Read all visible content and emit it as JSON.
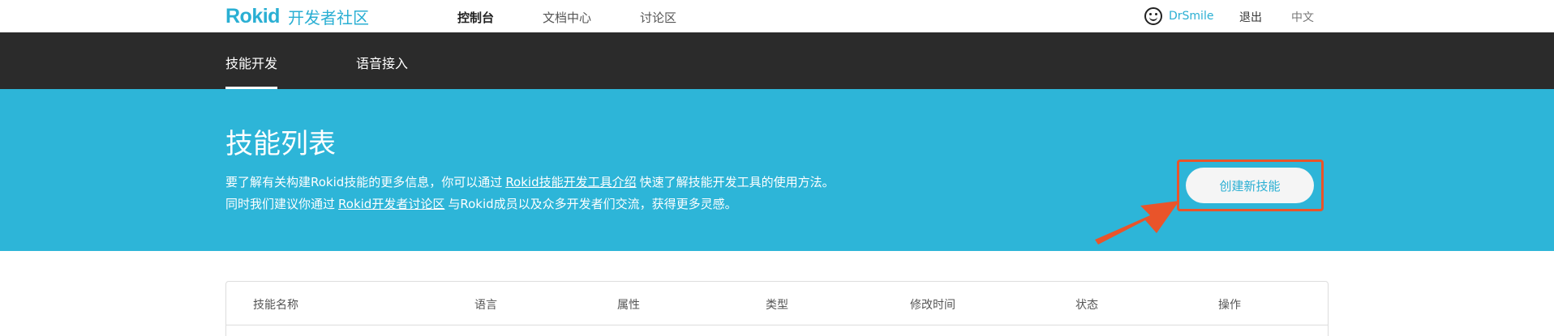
{
  "brand": {
    "logo": "Rokid",
    "name": "开发者社区"
  },
  "nav": {
    "items": [
      "控制台",
      "文档中心",
      "讨论区"
    ]
  },
  "user": {
    "name": "DrSmile",
    "logout": "退出",
    "language": "中文"
  },
  "subnav": {
    "tabs": [
      "技能开发",
      "语音接入"
    ]
  },
  "banner": {
    "title": "技能列表",
    "line1_prefix": "要了解有关构建Rokid技能的更多信息，你可以通过",
    "line1_link": "Rokid技能开发工具介绍",
    "line1_suffix": "快速了解技能开发工具的使用方法。",
    "line2_prefix": "同时我们建议你通过",
    "line2_link": "Rokid开发者讨论区",
    "line2_suffix": "与Rokid成员以及众多开发者们交流，获得更多灵感。",
    "create_button": "创建新技能"
  },
  "table": {
    "columns": [
      "技能名称",
      "语言",
      "属性",
      "类型",
      "修改时间",
      "状态",
      "操作"
    ]
  },
  "colors": {
    "accent": "#2aafd3",
    "banner": "#2db5d8",
    "subnav": "#2b2b2b",
    "highlight": "#e9542a"
  }
}
